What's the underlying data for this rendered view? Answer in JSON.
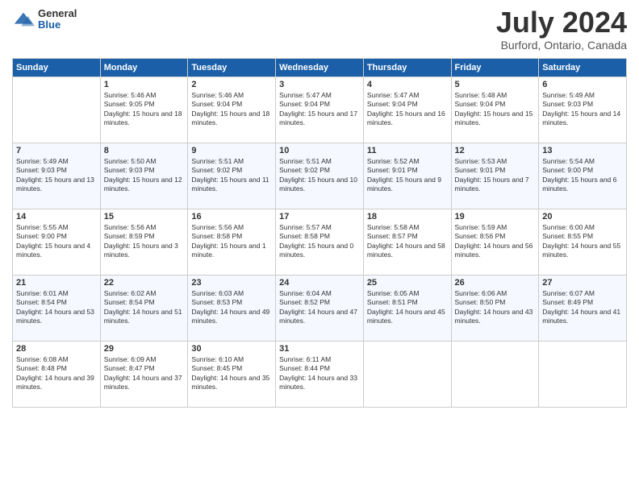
{
  "header": {
    "logo_general": "General",
    "logo_blue": "Blue",
    "month_year": "July 2024",
    "location": "Burford, Ontario, Canada"
  },
  "days_of_week": [
    "Sunday",
    "Monday",
    "Tuesday",
    "Wednesday",
    "Thursday",
    "Friday",
    "Saturday"
  ],
  "weeks": [
    [
      {
        "num": "",
        "empty": true
      },
      {
        "num": "1",
        "sunrise": "Sunrise: 5:46 AM",
        "sunset": "Sunset: 9:05 PM",
        "daylight": "Daylight: 15 hours and 18 minutes."
      },
      {
        "num": "2",
        "sunrise": "Sunrise: 5:46 AM",
        "sunset": "Sunset: 9:04 PM",
        "daylight": "Daylight: 15 hours and 18 minutes."
      },
      {
        "num": "3",
        "sunrise": "Sunrise: 5:47 AM",
        "sunset": "Sunset: 9:04 PM",
        "daylight": "Daylight: 15 hours and 17 minutes."
      },
      {
        "num": "4",
        "sunrise": "Sunrise: 5:47 AM",
        "sunset": "Sunset: 9:04 PM",
        "daylight": "Daylight: 15 hours and 16 minutes."
      },
      {
        "num": "5",
        "sunrise": "Sunrise: 5:48 AM",
        "sunset": "Sunset: 9:04 PM",
        "daylight": "Daylight: 15 hours and 15 minutes."
      },
      {
        "num": "6",
        "sunrise": "Sunrise: 5:49 AM",
        "sunset": "Sunset: 9:03 PM",
        "daylight": "Daylight: 15 hours and 14 minutes."
      }
    ],
    [
      {
        "num": "7",
        "sunrise": "Sunrise: 5:49 AM",
        "sunset": "Sunset: 9:03 PM",
        "daylight": "Daylight: 15 hours and 13 minutes."
      },
      {
        "num": "8",
        "sunrise": "Sunrise: 5:50 AM",
        "sunset": "Sunset: 9:03 PM",
        "daylight": "Daylight: 15 hours and 12 minutes."
      },
      {
        "num": "9",
        "sunrise": "Sunrise: 5:51 AM",
        "sunset": "Sunset: 9:02 PM",
        "daylight": "Daylight: 15 hours and 11 minutes."
      },
      {
        "num": "10",
        "sunrise": "Sunrise: 5:51 AM",
        "sunset": "Sunset: 9:02 PM",
        "daylight": "Daylight: 15 hours and 10 minutes."
      },
      {
        "num": "11",
        "sunrise": "Sunrise: 5:52 AM",
        "sunset": "Sunset: 9:01 PM",
        "daylight": "Daylight: 15 hours and 9 minutes."
      },
      {
        "num": "12",
        "sunrise": "Sunrise: 5:53 AM",
        "sunset": "Sunset: 9:01 PM",
        "daylight": "Daylight: 15 hours and 7 minutes."
      },
      {
        "num": "13",
        "sunrise": "Sunrise: 5:54 AM",
        "sunset": "Sunset: 9:00 PM",
        "daylight": "Daylight: 15 hours and 6 minutes."
      }
    ],
    [
      {
        "num": "14",
        "sunrise": "Sunrise: 5:55 AM",
        "sunset": "Sunset: 9:00 PM",
        "daylight": "Daylight: 15 hours and 4 minutes."
      },
      {
        "num": "15",
        "sunrise": "Sunrise: 5:56 AM",
        "sunset": "Sunset: 8:59 PM",
        "daylight": "Daylight: 15 hours and 3 minutes."
      },
      {
        "num": "16",
        "sunrise": "Sunrise: 5:56 AM",
        "sunset": "Sunset: 8:58 PM",
        "daylight": "Daylight: 15 hours and 1 minute."
      },
      {
        "num": "17",
        "sunrise": "Sunrise: 5:57 AM",
        "sunset": "Sunset: 8:58 PM",
        "daylight": "Daylight: 15 hours and 0 minutes."
      },
      {
        "num": "18",
        "sunrise": "Sunrise: 5:58 AM",
        "sunset": "Sunset: 8:57 PM",
        "daylight": "Daylight: 14 hours and 58 minutes."
      },
      {
        "num": "19",
        "sunrise": "Sunrise: 5:59 AM",
        "sunset": "Sunset: 8:56 PM",
        "daylight": "Daylight: 14 hours and 56 minutes."
      },
      {
        "num": "20",
        "sunrise": "Sunrise: 6:00 AM",
        "sunset": "Sunset: 8:55 PM",
        "daylight": "Daylight: 14 hours and 55 minutes."
      }
    ],
    [
      {
        "num": "21",
        "sunrise": "Sunrise: 6:01 AM",
        "sunset": "Sunset: 8:54 PM",
        "daylight": "Daylight: 14 hours and 53 minutes."
      },
      {
        "num": "22",
        "sunrise": "Sunrise: 6:02 AM",
        "sunset": "Sunset: 8:54 PM",
        "daylight": "Daylight: 14 hours and 51 minutes."
      },
      {
        "num": "23",
        "sunrise": "Sunrise: 6:03 AM",
        "sunset": "Sunset: 8:53 PM",
        "daylight": "Daylight: 14 hours and 49 minutes."
      },
      {
        "num": "24",
        "sunrise": "Sunrise: 6:04 AM",
        "sunset": "Sunset: 8:52 PM",
        "daylight": "Daylight: 14 hours and 47 minutes."
      },
      {
        "num": "25",
        "sunrise": "Sunrise: 6:05 AM",
        "sunset": "Sunset: 8:51 PM",
        "daylight": "Daylight: 14 hours and 45 minutes."
      },
      {
        "num": "26",
        "sunrise": "Sunrise: 6:06 AM",
        "sunset": "Sunset: 8:50 PM",
        "daylight": "Daylight: 14 hours and 43 minutes."
      },
      {
        "num": "27",
        "sunrise": "Sunrise: 6:07 AM",
        "sunset": "Sunset: 8:49 PM",
        "daylight": "Daylight: 14 hours and 41 minutes."
      }
    ],
    [
      {
        "num": "28",
        "sunrise": "Sunrise: 6:08 AM",
        "sunset": "Sunset: 8:48 PM",
        "daylight": "Daylight: 14 hours and 39 minutes."
      },
      {
        "num": "29",
        "sunrise": "Sunrise: 6:09 AM",
        "sunset": "Sunset: 8:47 PM",
        "daylight": "Daylight: 14 hours and 37 minutes."
      },
      {
        "num": "30",
        "sunrise": "Sunrise: 6:10 AM",
        "sunset": "Sunset: 8:45 PM",
        "daylight": "Daylight: 14 hours and 35 minutes."
      },
      {
        "num": "31",
        "sunrise": "Sunrise: 6:11 AM",
        "sunset": "Sunset: 8:44 PM",
        "daylight": "Daylight: 14 hours and 33 minutes."
      },
      {
        "num": "",
        "empty": true
      },
      {
        "num": "",
        "empty": true
      },
      {
        "num": "",
        "empty": true
      }
    ]
  ]
}
